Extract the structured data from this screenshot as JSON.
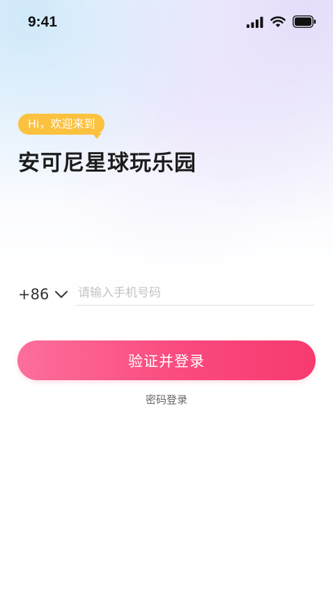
{
  "status_bar": {
    "time": "9:41",
    "icons": [
      "signal-icon",
      "wifi-icon",
      "battery-icon"
    ]
  },
  "greeting": {
    "bubble_text": "Hi，欢迎来到",
    "title": "安可尼星球玩乐园"
  },
  "login_form": {
    "country_code": "+86",
    "phone_placeholder": "请输入手机号码",
    "phone_value": "",
    "submit_label": "验证并登录",
    "alt_login_label": "密码登录"
  },
  "colors": {
    "bubble": "#fcc13e",
    "button_start": "#fc6f9c",
    "button_end": "#f73a6f"
  }
}
